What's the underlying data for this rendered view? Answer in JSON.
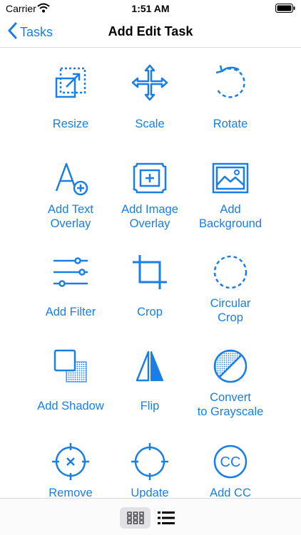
{
  "status": {
    "carrier": "Carrier",
    "time": "1:51 AM"
  },
  "nav": {
    "back_label": "Tasks",
    "title": "Add Edit Task"
  },
  "tiles": [
    {
      "label": "Resize",
      "icon": "resize-icon"
    },
    {
      "label": "Scale",
      "icon": "scale-icon"
    },
    {
      "label": "Rotate",
      "icon": "rotate-icon"
    },
    {
      "label": "Add Text\nOverlay",
      "icon": "text-overlay-icon"
    },
    {
      "label": "Add Image\nOverlay",
      "icon": "image-overlay-icon"
    },
    {
      "label": "Add\nBackground",
      "icon": "background-icon"
    },
    {
      "label": "Add Filter",
      "icon": "filter-sliders-icon"
    },
    {
      "label": "Crop",
      "icon": "crop-icon"
    },
    {
      "label": "Circular\nCrop",
      "icon": "circular-crop-icon"
    },
    {
      "label": "Add Shadow",
      "icon": "shadow-icon"
    },
    {
      "label": "Flip",
      "icon": "flip-icon"
    },
    {
      "label": "Convert\nto Grayscale",
      "icon": "grayscale-icon"
    },
    {
      "label": "Remove",
      "icon": "remove-target-icon"
    },
    {
      "label": "Update",
      "icon": "update-target-icon"
    },
    {
      "label": "Add CC",
      "icon": "cc-icon"
    }
  ],
  "view_toggle": {
    "selected": "grid",
    "options": [
      "grid-view-icon",
      "list-view-icon"
    ]
  },
  "colors": {
    "accent": "#1a7ee6",
    "text": "#000000",
    "separator": "#d9d9d9"
  }
}
